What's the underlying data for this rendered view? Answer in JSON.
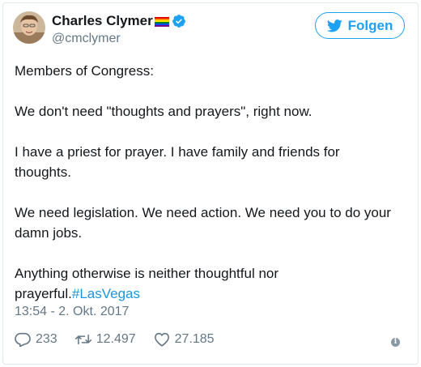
{
  "author": {
    "display_name": "Charles Clymer",
    "handle": "@cmclymer",
    "icons": [
      "rainbow-flag-emoji",
      "verified-badge-icon",
      "avatar-photo"
    ]
  },
  "follow_button": {
    "label": "Folgen",
    "icon": "twitter-bird-icon"
  },
  "tweet": {
    "paragraphs": [
      "Members of Congress:",
      "We don't need \"thoughts and prayers\", right now.",
      "I have a priest for prayer. I have family and friends for thoughts.",
      "We need legislation. We need action. We need you to do your damn jobs."
    ],
    "last_paragraph_text": "Anything otherwise is neither thoughtful nor prayerful.",
    "hashtag": "#LasVegas"
  },
  "timestamp": "13:54 - 2. Okt. 2017",
  "actions": {
    "replies": "233",
    "retweets": "12.497",
    "likes": "27.185"
  },
  "colors": {
    "accent": "#1da1f2",
    "hashtag": "#1b95e0",
    "secondary_text": "#657786",
    "border": "#e1e8ed"
  }
}
